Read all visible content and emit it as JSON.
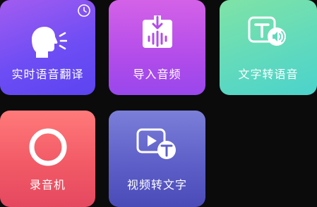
{
  "tiles": [
    {
      "label": "实时语音翻译",
      "icon": "speaking-head-icon",
      "badge_icon": "clock-icon"
    },
    {
      "label": "导入音频",
      "icon": "import-audio-icon"
    },
    {
      "label": "文字转语音",
      "icon": "text-to-speech-icon"
    },
    {
      "label": "录音机",
      "icon": "record-circle-icon"
    },
    {
      "label": "视频转文字",
      "icon": "video-to-text-icon"
    }
  ],
  "colors": {
    "background": "#0b0b0b",
    "tile1": "#6e4df4",
    "tile2": "#b24cea",
    "tile3": "#5fd9be",
    "tile4": "#f25a66",
    "tile5": "#5e5fc8"
  }
}
